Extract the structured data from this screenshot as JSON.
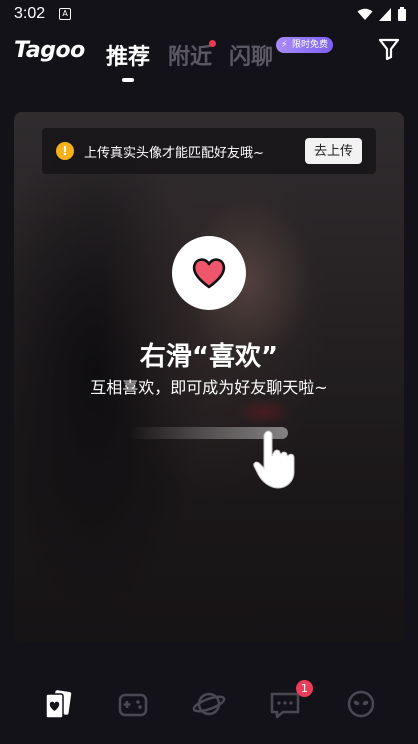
{
  "status_bar": {
    "time": "3:02",
    "notification_icon": "A"
  },
  "header": {
    "logo": "Tagoo",
    "tabs": [
      {
        "label": "推荐",
        "active": true
      },
      {
        "label": "附近",
        "active": false,
        "has_dot": true
      },
      {
        "label": "闪聊",
        "active": false
      }
    ],
    "promo_badge": "限时免费",
    "filter_icon": "filter-icon"
  },
  "card": {
    "tip_text": "上传真实头像才能匹配好友哦~",
    "tip_button": "去上传",
    "tip_icon": "info-icon",
    "heart_icon": "heart-icon",
    "title": "右滑“喜欢”",
    "subtitle": "互相喜欢，即可成为好友聊天啦~",
    "hand_icon": "swipe-hand-icon"
  },
  "bottom_nav": {
    "items": [
      {
        "icon": "cards-icon",
        "active": true
      },
      {
        "icon": "game-icon",
        "active": false
      },
      {
        "icon": "planet-icon",
        "active": false
      },
      {
        "icon": "message-icon",
        "active": false,
        "badge": "1"
      },
      {
        "icon": "alien-icon",
        "active": false
      }
    ]
  },
  "colors": {
    "background": "#141219",
    "accent": "#e83a4d",
    "tip_icon": "#f5b21a",
    "promo": "#8b6ef4"
  }
}
